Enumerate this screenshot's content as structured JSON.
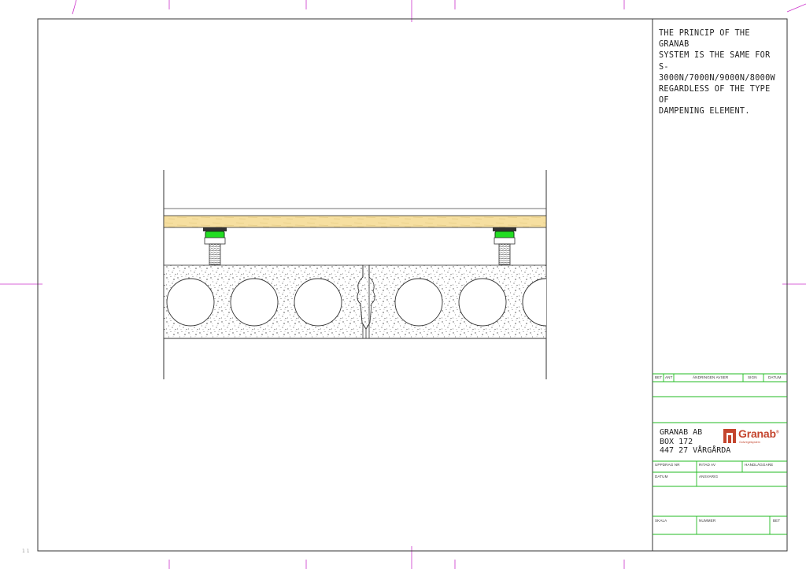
{
  "note": {
    "text": "THE PRINCIP OF THE GRANAB\nSYSTEM IS THE SAME FOR\nS-3000N/7000N/9000N/8000W\nREGARDLESS OF THE TYPE OF\nDAMPENING ELEMENT."
  },
  "title_block": {
    "header": {
      "bet": "BET",
      "ant": "ANT",
      "andringen": "ÄNDRINGEN AVSER",
      "sign": "SIGN",
      "datum": "DATUM"
    },
    "address": {
      "line1": "GRANAB AB",
      "line2": "BOX 172",
      "line3": "447 27 VÅRGÅRDA"
    },
    "logo": {
      "word": "Granab",
      "registered": "®",
      "tagline": "Golvregelsystem"
    },
    "fields": {
      "uppdrag_nr": "UPPDRAG NR",
      "ritad_av": "RITAD AV",
      "handlaggare": "HANDLÄGGARE",
      "datum": "DATUM",
      "ansvarig": "ANSVARIG",
      "skala": "SKALA",
      "nummer": "NUMMER",
      "bet": "BET"
    }
  },
  "corner_mark": "1 1",
  "colors": {
    "frame": "#333333",
    "registration": "#cc33cc",
    "titleblock_lines": "#22bb22",
    "board": "#f6dfa0",
    "damper": "#22dd22",
    "concrete_speckle": "#555555",
    "logo": "#c4452e"
  }
}
